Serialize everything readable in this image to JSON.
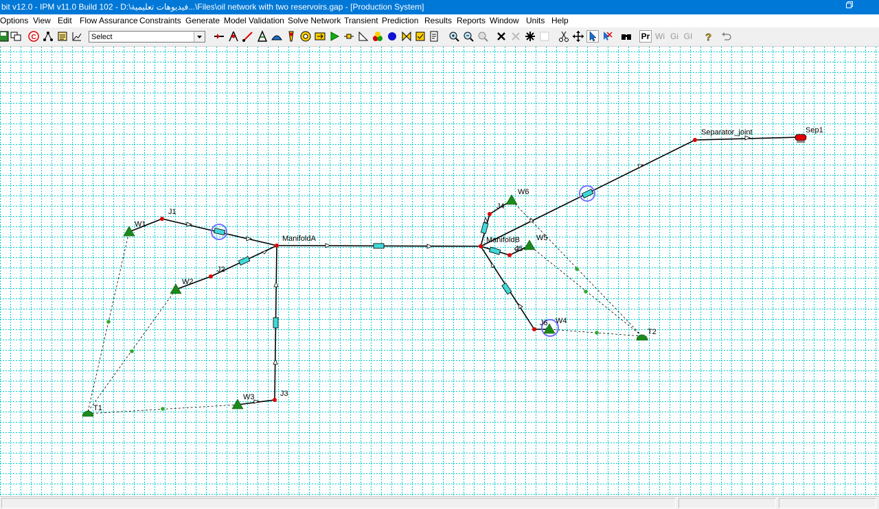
{
  "window": {
    "title": "bit v12.0 - IPM v11.0 Build 102 - D:\\فيديوهات تعليمية...\\Files\\oil network with two reservoirs.gap - [Production System]"
  },
  "menu": {
    "items": [
      "Options",
      "View",
      "Edit",
      "Flow Assurance",
      "Constraints",
      "Generate",
      "Model Validation",
      "Solve Network",
      "Transient",
      "Prediction",
      "Results",
      "Reports",
      "Window",
      "Units",
      "Help"
    ]
  },
  "toolbar": {
    "select_value": "Select",
    "text_buttons": [
      "Pr",
      "Wi",
      "Gi",
      "GI"
    ]
  },
  "network": {
    "separator_label": "Separator_joint",
    "sep_label": "Sep1",
    "manifold_a_label": "ManifoldA",
    "manifold_b_label": "ManifoldB",
    "wells": {
      "w1": "W1",
      "w2": "W2",
      "w3": "W3",
      "w4": "W4",
      "w5": "W5",
      "w6": "W6"
    },
    "joints": {
      "j1": "J1",
      "j2": "J2",
      "j3": "J3",
      "j4": "J4",
      "j5": "J5",
      "j6": "J6"
    },
    "tanks": {
      "t1": "T1",
      "t2": "T2"
    }
  },
  "colors": {
    "titlebar": "#0078d7",
    "grid": "#00c8c8",
    "well": "#1b8a1b",
    "joint": "#e00000",
    "pipe_equipment": "#40d8d8",
    "highlight": "#7070ff"
  }
}
